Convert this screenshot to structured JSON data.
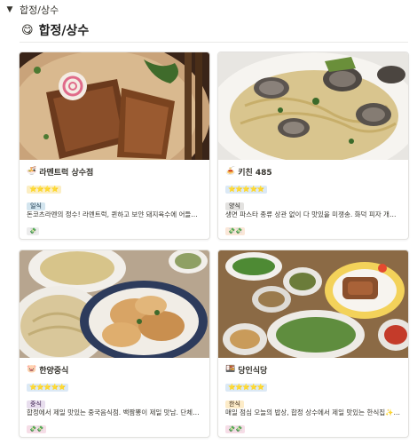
{
  "toggle": {
    "label": "합정/상수"
  },
  "page": {
    "emoji": "😋",
    "title": "합정/상수"
  },
  "cards": [
    {
      "emoji": "🍜",
      "name": "라멘트럭 상수점",
      "rating": "⭐⭐⭐⭐",
      "tag": "일식",
      "tag_bg": "#d3e5ef",
      "tag_fg": "#183347",
      "desc": "돈코츠라멘의 정수! 라멘트럭, 퀸하고 보얀 돼지육수에 어들어들...",
      "price": "💸"
    },
    {
      "emoji": "🍝",
      "name": "키친 485",
      "rating": "⭐⭐⭐⭐⭐",
      "tag": "양식",
      "tag_bg": "#e3e2e0",
      "tag_fg": "#32302c",
      "desc": "생면 파스타 종류 상관 없이 다 맛있을 미쟁송. 화덕 피자 개존맛",
      "price": "💸💸"
    },
    {
      "emoji": "🐷",
      "name": "한양중식",
      "rating": "⭐⭐⭐⭐⭐",
      "tag": "중식",
      "tag_bg": "#e8deee",
      "tag_fg": "#412454",
      "desc": "합정에서 제일 맛있는 중국음식점. 백짬뽕이 제일 맛남. 단체예약...",
      "price": "💸💸"
    },
    {
      "emoji": "🍱",
      "name": "당인식당",
      "rating": "⭐⭐⭐⭐⭐",
      "tag": "한식",
      "tag_bg": "#fdecc8",
      "tag_fg": "#402c1b",
      "desc": "매일 점심 오늘의 밥상, 합정 상수에서 제일 맛있는 한식집✨공...",
      "price": "💸💸"
    }
  ]
}
